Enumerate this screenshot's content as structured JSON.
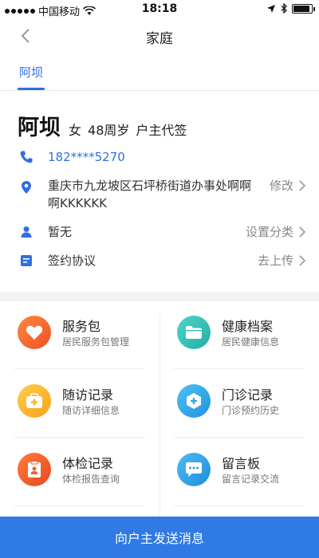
{
  "status_bar": {
    "carrier": "中国移动",
    "time": "18:18"
  },
  "nav": {
    "title": "家庭"
  },
  "tabs": [
    {
      "label": "阿坝"
    }
  ],
  "profile": {
    "name": "阿坝",
    "gender": "女",
    "age": "48周岁",
    "role": "户主代签",
    "phone": "182****5270",
    "address_line1": "重庆市九龙坡区石坪桥街道办事处啊啊",
    "address_line2": "啊KKKKKK",
    "address_action": "修改",
    "category_value": "暂无",
    "category_action": "设置分类",
    "agreement_label": "签约协议",
    "agreement_action": "去上传"
  },
  "grid": [
    {
      "title": "服务包",
      "subtitle": "居民服务包管理",
      "icon": "heart-icon",
      "color": "#f26a2d"
    },
    {
      "title": "健康档案",
      "subtitle": "居民健康信息",
      "icon": "folder-icon",
      "color": "#2fc0b8"
    },
    {
      "title": "随访记录",
      "subtitle": "随访详细信息",
      "icon": "medkit-icon",
      "color": "#f8b32a"
    },
    {
      "title": "门诊记录",
      "subtitle": "门诊预约历史",
      "icon": "clinic-icon",
      "color": "#2fa7ea"
    },
    {
      "title": "体检记录",
      "subtitle": "体检报告查询",
      "icon": "report-icon",
      "color": "#f0602f"
    },
    {
      "title": "留言板",
      "subtitle": "留言记录交流",
      "icon": "chat-icon",
      "color": "#2b9fe8"
    }
  ],
  "bottom_button": {
    "label": "向户主发送消息"
  },
  "colors": {
    "accent": "#2f6fe4",
    "button": "#2f7ae5"
  }
}
